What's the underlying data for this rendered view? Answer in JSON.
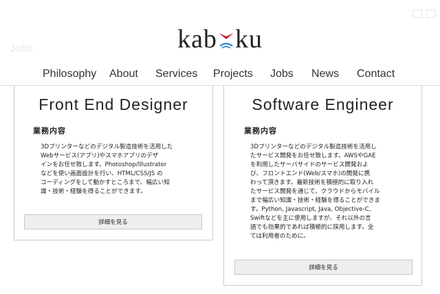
{
  "logo": {
    "part1": "kab",
    "part2": "ku"
  },
  "ghost_text": "Jobs",
  "nav": {
    "items": [
      {
        "label": "Philosophy"
      },
      {
        "label": "About"
      },
      {
        "label": "Services"
      },
      {
        "label": "Projects"
      },
      {
        "label": "Jobs"
      },
      {
        "label": "News"
      },
      {
        "label": "Contact"
      }
    ]
  },
  "jobs": [
    {
      "title": "Front End Designer",
      "section_label": "業務内容",
      "description_lines": [
        "3Dプリンターなどのデジタル製造技術を活用した",
        "Webサービス(アプリ)やスマホアプリのデザ",
        "インをお任せ致します。Photoshop/Illustrator",
        "などを使い画面設計を行い、HTML/CSS/JS の",
        "コーディングをして動かすところまで、幅広い知",
        "識・技術・経験を得ることができます。"
      ],
      "button_label": "詳細を見る"
    },
    {
      "title": "Software Engineer",
      "section_label": "業務内容",
      "description_lines": [
        "3Dプリンターなどのデジタル製造技術を活用し",
        "たサービス開発をお任せ致します。AWSやGAE",
        "を利用したサーバサイドのサービス開発およ",
        "び、フロントエンド(Web/スマホ)の開発に携",
        "わって頂きます。最新技術を積極的に取り入れ",
        "たサービス開発を通じて、クラウドからモバイル",
        "まで幅広い知識・技術・経験を得ることができま",
        "す。Python, Javascript, Java, Objective-C,",
        "Swiftなどを主に使用しますが、それ以外の言",
        "語でも効果的であれば積極的に採用します。全",
        "ては利用者のために。"
      ],
      "button_label": "詳細を見る"
    }
  ],
  "colors": {
    "logo_bird_red": "#c8202c",
    "logo_bird_blue": "#2f7fd0",
    "button_bg": "#eeeeee",
    "card_border": "#cccccc"
  }
}
